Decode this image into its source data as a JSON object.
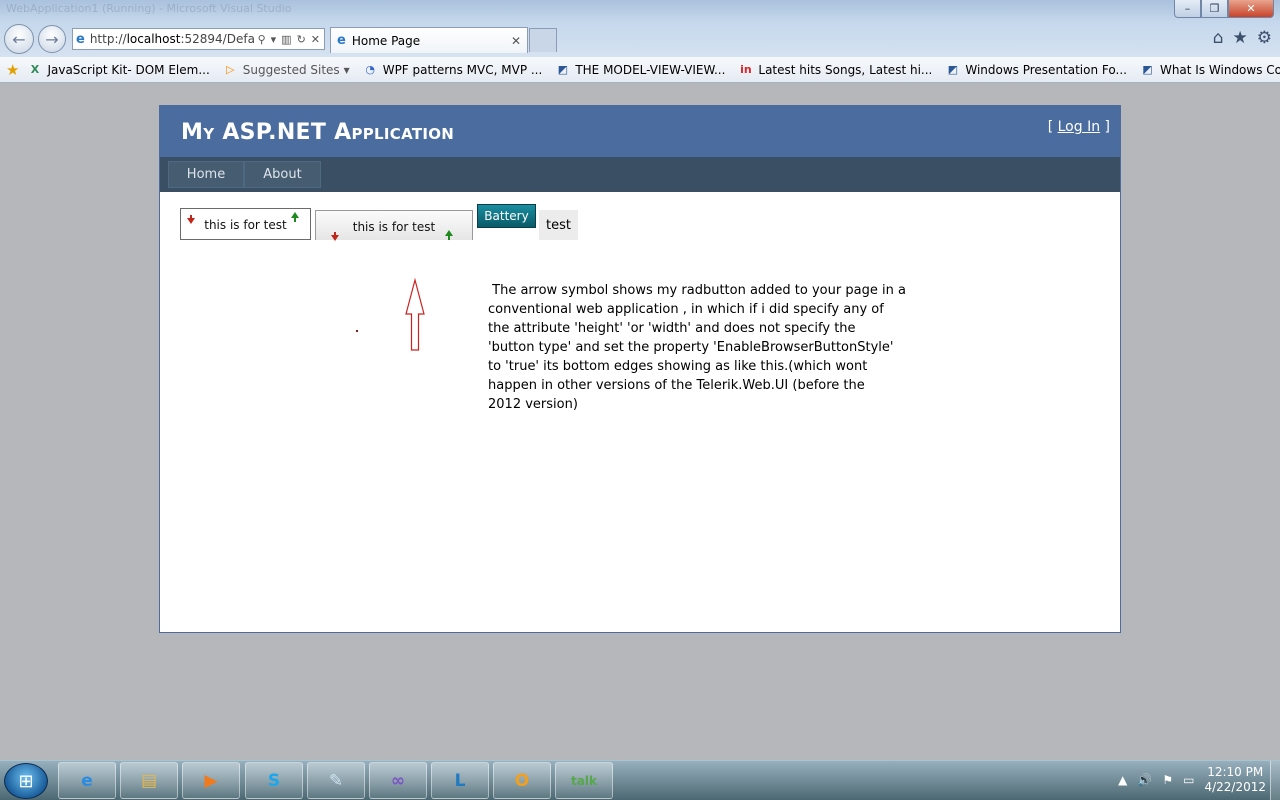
{
  "window": {
    "ghost_title": "WebApplication1 (Running) - Microsoft Visual Studio",
    "minimize": "–",
    "maximize": "❐",
    "close": "✕"
  },
  "browser": {
    "back": "←",
    "forward": "→",
    "address_prefix": "http://",
    "address_host": "localhost",
    "address_rest": ":52894/Defa",
    "address_tools": [
      "⚲",
      "▾",
      "▥",
      "↻",
      "✕"
    ],
    "tab_title": "Home Page",
    "tab_close": "✕",
    "right_icons": [
      "⌂",
      "★",
      "⚙"
    ]
  },
  "favorites": [
    {
      "label": "JavaScript Kit- DOM Elem...",
      "icon": "X",
      "color": "#2e8b57"
    },
    {
      "label": "Suggested Sites",
      "icon": "▷",
      "color": "#ff8c00",
      "dropdown": "▾"
    },
    {
      "label": "WPF patterns  MVC, MVP ...",
      "icon": "◔",
      "color": "#3366cc"
    },
    {
      "label": "THE MODEL-VIEW-VIEW...",
      "icon": "◩",
      "color": "#2b5797"
    },
    {
      "label": "Latest hits Songs, Latest hi...",
      "icon": "in",
      "color": "#d6262b"
    },
    {
      "label": "Windows Presentation Fo...",
      "icon": "◩",
      "color": "#2b5797"
    },
    {
      "label": "What Is Windows Commu...",
      "icon": "◩",
      "color": "#2b5797"
    }
  ],
  "app": {
    "title": "My ASP.NET Application",
    "login_open": "[ ",
    "login_link": "Log In",
    "login_close": " ]",
    "menu": [
      "Home",
      "About"
    ]
  },
  "content": {
    "radbutton1_label": "this is for test",
    "radbutton2_label": "this is for test",
    "battery_label": "Battery",
    "test_label": "test",
    "explanation": " The arrow symbol shows my radbutton added to your page in a\nconventional web application , in which if i did specify any of\nthe attribute 'height' 'or 'width' and does not specify the\n'button type' and set the property 'EnableBrowserButtonStyle'\nto 'true' its bottom edges showing as like this.(which wont\nhappen in other versions of the Telerik.Web.UI (before the\n2012 version)"
  },
  "taskbar": {
    "start": "⊞",
    "apps": [
      {
        "name": "internet-explorer",
        "glyph": "e",
        "color": "#2a8be0"
      },
      {
        "name": "windows-explorer",
        "glyph": "▤",
        "color": "#e8b84a"
      },
      {
        "name": "media-player",
        "glyph": "▶",
        "color": "#f07a1c"
      },
      {
        "name": "skype",
        "glyph": "S",
        "color": "#1aa7ec"
      },
      {
        "name": "notepad",
        "glyph": "✎",
        "color": "#cfe3f0"
      },
      {
        "name": "visual-studio",
        "glyph": "∞",
        "color": "#7c52c4"
      },
      {
        "name": "lync",
        "glyph": "L",
        "color": "#1f7ac2"
      },
      {
        "name": "outlook",
        "glyph": "O",
        "color": "#f0a020"
      },
      {
        "name": "google-talk",
        "glyph": "talk",
        "color": "#55a84a"
      }
    ],
    "tray_icons": [
      "▲",
      "🔊",
      "⚑",
      "▭"
    ],
    "time": "12:10 PM",
    "date": "4/22/2012"
  }
}
